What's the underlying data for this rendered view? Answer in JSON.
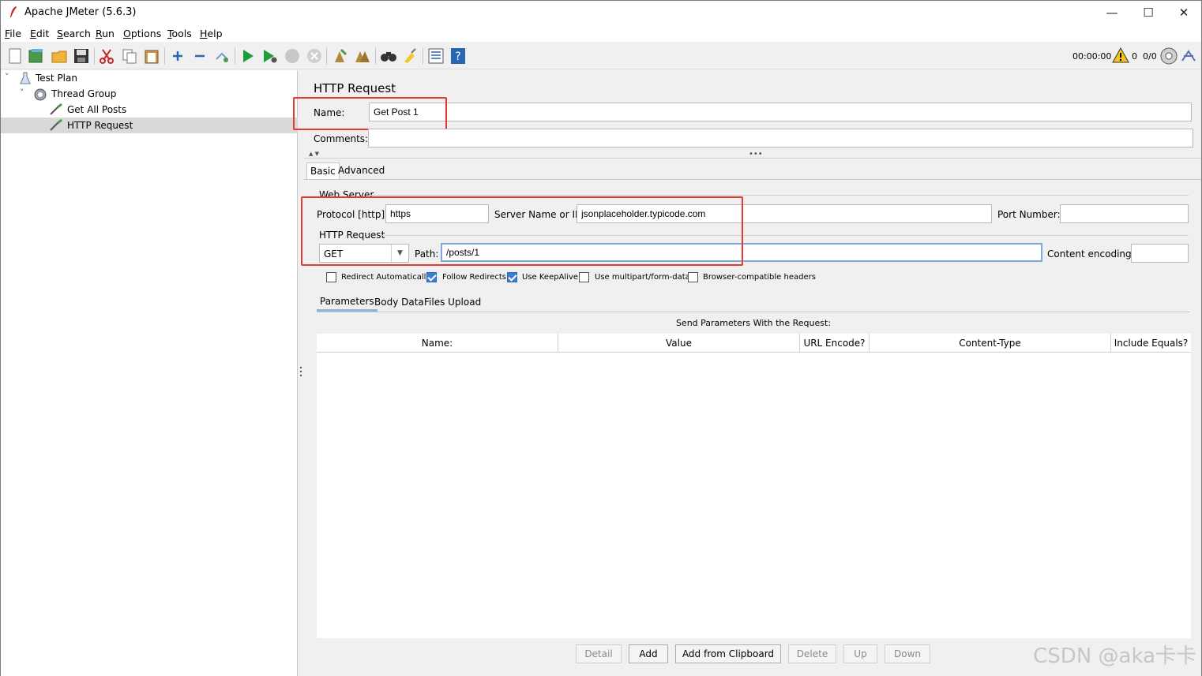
{
  "window": {
    "title": "Apache JMeter (5.6.3)",
    "controls": [
      "—",
      "☐",
      "✕"
    ]
  },
  "menu": {
    "items": [
      {
        "label": "File",
        "mnemonic": "F",
        "rest": "ile"
      },
      {
        "label": "Edit",
        "mnemonic": "E",
        "rest": "dit"
      },
      {
        "label": "Search",
        "mnemonic": "S",
        "rest": "earch"
      },
      {
        "label": "Run",
        "mnemonic": "R",
        "rest": "un"
      },
      {
        "label": "Options",
        "mnemonic": "O",
        "rest": "ptions"
      },
      {
        "label": "Tools",
        "mnemonic": "T",
        "rest": "ools"
      },
      {
        "label": "Help",
        "mnemonic": "H",
        "rest": "elp"
      }
    ]
  },
  "toolbar": {
    "elapsed": "00:00:00",
    "warnings": "0",
    "threads": "0/0",
    "icons": [
      "new-icon",
      "templates-icon",
      "open-icon",
      "save-icon",
      "cut-icon",
      "copy-icon",
      "paste-icon",
      "expand-icon",
      "collapse-icon",
      "toggle-icon",
      "start-icon",
      "start-no-pause-icon",
      "stop-icon",
      "shutdown-icon",
      "clear-icon",
      "clear-all-icon",
      "search-icon",
      "reset-search-icon",
      "function-helper-icon",
      "help-icon"
    ]
  },
  "tree": {
    "items": [
      {
        "label": "Test Plan",
        "icon": "test-plan-icon"
      },
      {
        "label": "Thread Group",
        "icon": "thread-group-icon"
      },
      {
        "label": "Get All Posts",
        "icon": "sampler-icon"
      },
      {
        "label": "HTTP Request",
        "icon": "sampler-icon",
        "selected": true
      }
    ]
  },
  "panel": {
    "heading": "HTTP Request",
    "name_label": "Name:",
    "name_value": "Get Post 1",
    "comments_label": "Comments:",
    "comments_value": "",
    "tabs": [
      "Basic",
      "Advanced"
    ],
    "active_tab": "Basic",
    "web_server": {
      "legend": "Web Server",
      "protocol_label": "Protocol [http]:",
      "protocol_value": "https",
      "server_label": "Server Name or IP:",
      "server_value": "jsonplaceholder.typicode.com",
      "port_label": "Port Number:",
      "port_value": ""
    },
    "http_request": {
      "legend": "HTTP Request",
      "method": "GET",
      "path_label": "Path:",
      "path_value": "/posts/1",
      "encoding_label": "Content encoding:",
      "encoding_value": ""
    },
    "checkboxes": [
      {
        "label": "Redirect Automatically",
        "checked": false
      },
      {
        "label": "Follow Redirects",
        "checked": true
      },
      {
        "label": "Use KeepAlive",
        "checked": true
      },
      {
        "label": "Use multipart/form-data",
        "checked": false
      },
      {
        "label": "Browser-compatible headers",
        "checked": false
      }
    ],
    "sub_tabs": [
      "Parameters",
      "Body Data",
      "Files Upload"
    ],
    "params_caption": "Send Parameters With the Request:",
    "columns": [
      "Name:",
      "Value",
      "URL Encode?",
      "Content-Type",
      "Include Equals?"
    ],
    "buttons": [
      {
        "label": "Detail",
        "enabled": false
      },
      {
        "label": "Add",
        "enabled": true
      },
      {
        "label": "Add from Clipboard",
        "enabled": true
      },
      {
        "label": "Delete",
        "enabled": false
      },
      {
        "label": "Up",
        "enabled": false
      },
      {
        "label": "Down",
        "enabled": false
      }
    ]
  },
  "watermark": "CSDN @aka卡卡",
  "colors": {
    "highlight": "#e53935",
    "selection": "#d9d9d9",
    "check": "#3b7fd1"
  }
}
